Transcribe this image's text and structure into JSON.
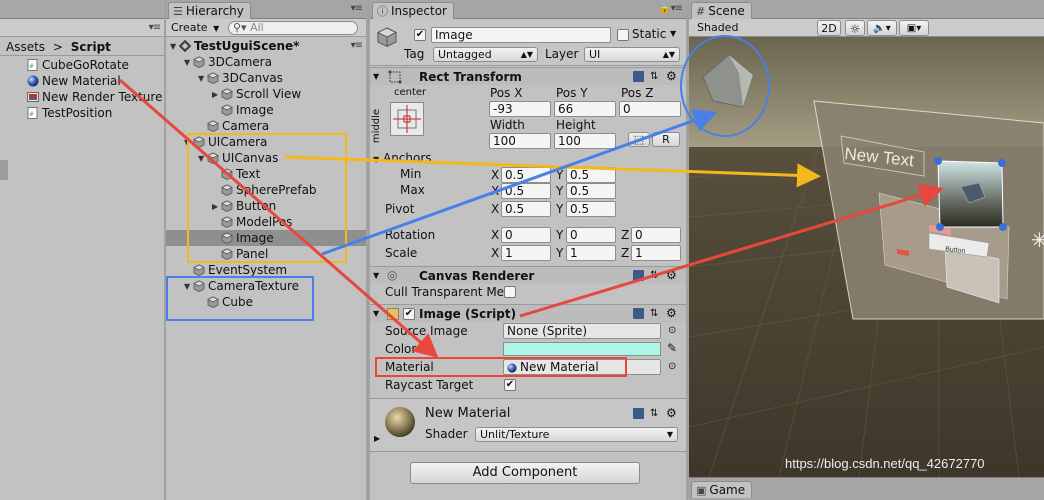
{
  "project": {
    "breadcrumb": [
      "Assets",
      "Script"
    ],
    "sep": ">",
    "items": [
      {
        "label": "CubeGoRotate",
        "icon": "cs-script-icon"
      },
      {
        "label": "New Material",
        "icon": "material-sphere-icon"
      },
      {
        "label": "New Render Texture",
        "icon": "render-texture-icon"
      },
      {
        "label": "TestPosition",
        "icon": "cs-script-icon"
      }
    ]
  },
  "hierarchy": {
    "tab": "Hierarchy",
    "create": "Create",
    "search_placeholder": "All",
    "scene_name": "TestUguiScene*",
    "rows": [
      {
        "label": "3DCamera",
        "depth": 1,
        "arrow": "down"
      },
      {
        "label": "3DCanvas",
        "depth": 2,
        "arrow": "down"
      },
      {
        "label": "Scroll View",
        "depth": 3,
        "arrow": "right"
      },
      {
        "label": "Image",
        "depth": 3,
        "arrow": ""
      },
      {
        "label": "Camera",
        "depth": 2,
        "arrow": ""
      },
      {
        "label": "UICamera",
        "depth": 1,
        "arrow": "down"
      },
      {
        "label": "UICanvas",
        "depth": 2,
        "arrow": "down"
      },
      {
        "label": "Text",
        "depth": 3,
        "arrow": ""
      },
      {
        "label": "SpherePrefab",
        "depth": 3,
        "arrow": ""
      },
      {
        "label": "Button",
        "depth": 3,
        "arrow": "right"
      },
      {
        "label": "ModelPos",
        "depth": 3,
        "arrow": ""
      },
      {
        "label": "Image",
        "depth": 3,
        "arrow": "",
        "selected": true
      },
      {
        "label": "Panel",
        "depth": 3,
        "arrow": ""
      },
      {
        "label": "EventSystem",
        "depth": 1,
        "arrow": ""
      },
      {
        "label": "CameraTexture",
        "depth": 1,
        "arrow": "down"
      },
      {
        "label": "Cube",
        "depth": 2,
        "arrow": ""
      }
    ]
  },
  "inspector": {
    "tab": "Inspector",
    "object_name": "Image",
    "static_label": "Static",
    "tag_label": "Tag",
    "tag_value": "Untagged",
    "layer_label": "Layer",
    "layer_value": "UI",
    "rect": {
      "title": "Rect Transform",
      "anchor_h": "center",
      "anchor_v": "middle",
      "pos_x_label": "Pos X",
      "pos_y_label": "Pos Y",
      "pos_z_label": "Pos Z",
      "pos_x": "-93",
      "pos_y": "66",
      "pos_z": "0",
      "width_label": "Width",
      "height_label": "Height",
      "width": "100",
      "height": "100",
      "r_label": "R",
      "anchors_label": "Anchors",
      "min_label": "Min",
      "max_label": "Max",
      "pivot_label": "Pivot",
      "x": "X",
      "y": "Y",
      "z": "Z",
      "min_x": "0.5",
      "min_y": "0.5",
      "max_x": "0.5",
      "max_y": "0.5",
      "pivot_x": "0.5",
      "pivot_y": "0.5",
      "rotation_label": "Rotation",
      "scale_label": "Scale",
      "rot_x": "0",
      "rot_y": "0",
      "rot_z": "0",
      "scale_x": "1",
      "scale_y": "1",
      "scale_z": "1"
    },
    "canvas_renderer": {
      "title": "Canvas Renderer",
      "cull_label": "Cull Transparent Me"
    },
    "image": {
      "title": "Image (Script)",
      "source_label": "Source Image",
      "source_value": "None (Sprite)",
      "color_label": "Color",
      "color_value": "#aff5e7",
      "material_label": "Material",
      "material_value": "New Material",
      "raycast_label": "Raycast Target"
    },
    "material": {
      "name": "New Material",
      "shader_label": "Shader",
      "shader_value": "Unlit/Texture"
    },
    "add_component": "Add Component"
  },
  "scene": {
    "tab": "Scene",
    "shaded": "Shaded",
    "mode_2d": "2D",
    "new_text": "New Text",
    "button_text": "Button",
    "game_tab": "Game",
    "watermark": "https://blog.csdn.net/qq_42672770"
  },
  "colors": {
    "panel_bg": "#c2c2c2",
    "selection": "#8f8f8f",
    "annot_red": "#e8473d",
    "annot_yellow": "#f5b81c",
    "annot_blue": "#4a7fe8",
    "image_color": "#aff5e7"
  }
}
